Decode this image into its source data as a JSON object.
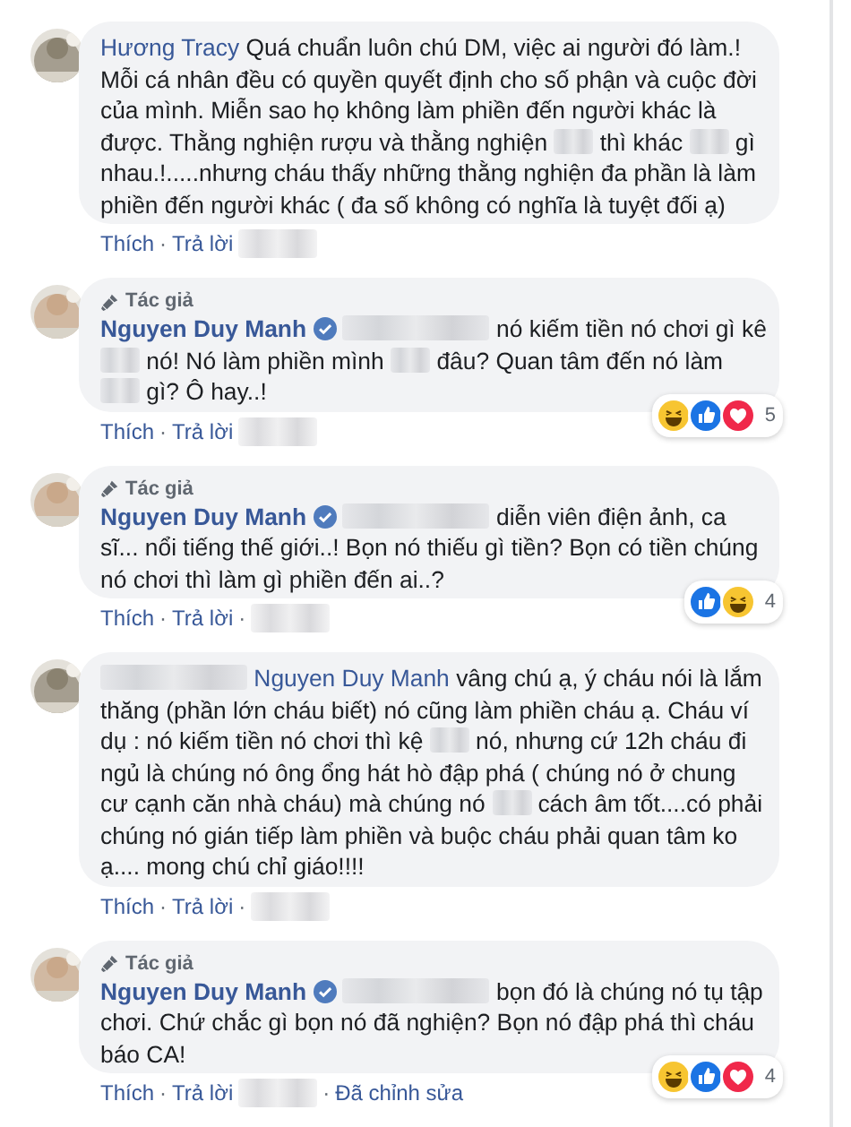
{
  "comments": [
    {
      "avatar": {
        "kind": "picture"
      },
      "author": {
        "text": "Hương Tracy",
        "post_author": false
      },
      "segments": [
        {
          "kind": "text",
          "text": "Quá chuẩn luôn chú DM, việc ai người đó làm.! Mỗi cá nhân đều có quyền quyết định cho số phận và cuộc đời của mình. Miễn sao họ không làm phiền đến người khác là được. Thằng nghiện rượu và thằng nghiện"
        },
        {
          "kind": "redacted"
        },
        {
          "kind": "text",
          "text": "thì khác"
        },
        {
          "kind": "redacted"
        },
        {
          "kind": "text",
          "text": "gì nhau.!.....nhưng cháu thấy những thằng nghiện đa phần là làm phiền đến người khác ( đa số không có nghĩa là tuyệt đối ạ)"
        }
      ],
      "actions": [
        {
          "kind": "link",
          "text": "Thích"
        },
        {
          "kind": "separator",
          "text": "·"
        },
        {
          "kind": "link",
          "text": "Trả lời"
        },
        {
          "kind": "redacted"
        }
      ]
    },
    {
      "avatar": {
        "kind": "picture"
      },
      "author_label": "Tác giả",
      "author": {
        "text": "Nguyen Duy Manh",
        "post_author": true
      },
      "verified": true,
      "segments": [
        {
          "kind": "redacted"
        },
        {
          "kind": "text",
          "text": "nó kiếm tiền nó chơi gì kê"
        },
        {
          "kind": "redacted"
        },
        {
          "kind": "text",
          "text": "nó! Nó làm phiền mình"
        },
        {
          "kind": "redacted"
        },
        {
          "kind": "text",
          "text": "đâu? Quan tâm đến nó làm"
        },
        {
          "kind": "redacted"
        },
        {
          "kind": "text",
          "text": "gì? Ô hay..!"
        }
      ],
      "actions": [
        {
          "kind": "link",
          "text": "Thích"
        },
        {
          "kind": "separator",
          "text": "·"
        },
        {
          "kind": "link",
          "text": "Trả lời"
        },
        {
          "kind": "redacted"
        }
      ],
      "reactions": {
        "icons": [
          {
            "kind": "haha"
          },
          {
            "kind": "like"
          },
          {
            "kind": "love"
          }
        ],
        "count": "5"
      }
    },
    {
      "avatar": {
        "kind": "picture"
      },
      "author_label": "Tác giả",
      "author": {
        "text": "Nguyen Duy Manh",
        "post_author": true
      },
      "verified": true,
      "segments": [
        {
          "kind": "redacted"
        },
        {
          "kind": "text",
          "text": "diễn viên điện ảnh, ca sĩ... nổi tiếng thế giới..! Bọn nó thiếu gì tiền? Bọn có tiền chúng nó chơi thì làm gì phiền đến ai..?"
        }
      ],
      "actions": [
        {
          "kind": "link",
          "text": "Thích"
        },
        {
          "kind": "separator",
          "text": "·"
        },
        {
          "kind": "link",
          "text": "Trả lời"
        },
        {
          "kind": "separator",
          "text": "·"
        },
        {
          "kind": "redacted"
        }
      ],
      "reactions": {
        "icons": [
          {
            "kind": "like"
          },
          {
            "kind": "haha"
          }
        ],
        "count": "4"
      }
    },
    {
      "avatar": {
        "kind": "picture"
      },
      "segments": [
        {
          "kind": "redacted"
        },
        {
          "kind": "mention",
          "text": "Nguyen Duy Manh"
        },
        {
          "kind": "text",
          "text": "vâng chú ạ, ý cháu nói là lắm thăng (phần lớn cháu biết) nó cũng làm phiền cháu ạ. Cháu ví dụ : nó kiếm tiền nó chơi thì kệ"
        },
        {
          "kind": "redacted"
        },
        {
          "kind": "text",
          "text": "nó, nhưng cứ 12h cháu đi ngủ là chúng nó ông ổng hát hò đập phá ( chúng nó ở chung cư cạnh căn nhà cháu) mà chúng nó"
        },
        {
          "kind": "redacted"
        },
        {
          "kind": "text",
          "text": "cách âm tốt....có phải chúng nó gián tiếp làm phiền và buộc cháu phải quan tâm ko ạ.... mong chú chỉ giáo!!!!"
        }
      ],
      "actions": [
        {
          "kind": "link",
          "text": "Thích"
        },
        {
          "kind": "separator",
          "text": "·"
        },
        {
          "kind": "link",
          "text": "Trả lời"
        },
        {
          "kind": "separator",
          "text": "·"
        },
        {
          "kind": "redacted"
        }
      ]
    },
    {
      "avatar": {
        "kind": "picture"
      },
      "author_label": "Tác giả",
      "author": {
        "text": "Nguyen Duy Manh",
        "post_author": true
      },
      "verified": true,
      "segments": [
        {
          "kind": "redacted"
        },
        {
          "kind": "text",
          "text": "bọn đó là chúng nó tụ tập chơi. Chứ chắc gì bọn nó đã nghiện? Bọn nó đập phá thì cháu báo CA!"
        }
      ],
      "actions": [
        {
          "kind": "link",
          "text": "Thích"
        },
        {
          "kind": "separator",
          "text": "·"
        },
        {
          "kind": "link",
          "text": "Trả lời"
        },
        {
          "kind": "redacted"
        },
        {
          "kind": "separator",
          "text": "·"
        },
        {
          "kind": "plain",
          "text": "Đã chỉnh sửa"
        }
      ],
      "reactions": {
        "icons": [
          {
            "kind": "haha"
          },
          {
            "kind": "like"
          },
          {
            "kind": "love"
          }
        ],
        "count": "4"
      }
    }
  ]
}
